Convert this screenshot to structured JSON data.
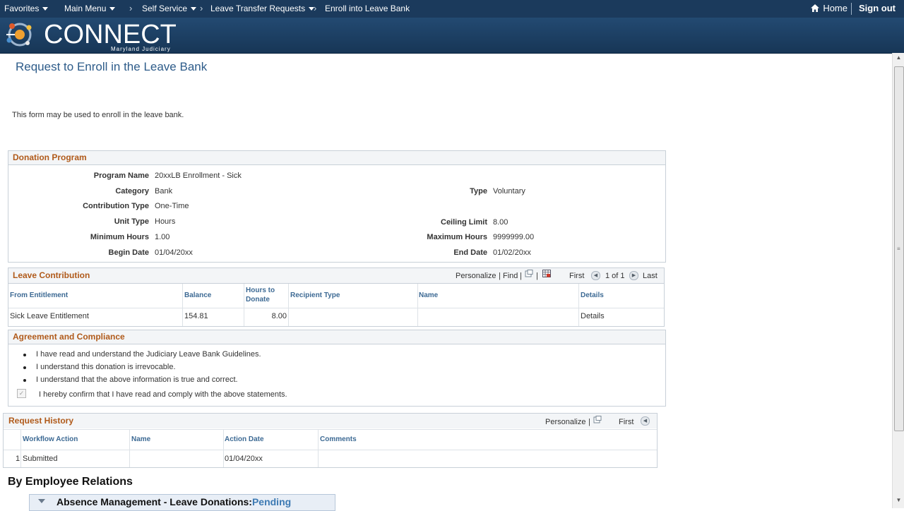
{
  "topnav": {
    "favorites": "Favorites",
    "main_menu": "Main Menu",
    "self_service": "Self Service",
    "leave_transfer": "Leave Transfer Requests",
    "current": "Enroll into Leave Bank",
    "home": "Home",
    "signout": "Sign out"
  },
  "brand": {
    "name": "CONNECT",
    "sub": "Maryland Judiciary"
  },
  "page": {
    "title": "Request to Enroll in the Leave Bank",
    "intro": "This form may be used to enroll in the leave bank."
  },
  "donation": {
    "title": "Donation Program",
    "program_name_label": "Program Name",
    "program_name": "20xxLB Enrollment - Sick",
    "category_label": "Category",
    "category": "Bank",
    "type_label": "Type",
    "type": "Voluntary",
    "contribution_type_label": "Contribution Type",
    "contribution_type": "One-Time",
    "unit_type_label": "Unit Type",
    "unit_type": "Hours",
    "ceiling_label": "Ceiling Limit",
    "ceiling": "8.00",
    "min_hours_label": "Minimum Hours",
    "min_hours": "1.00",
    "max_hours_label": "Maximum Hours",
    "max_hours": "9999999.00",
    "begin_label": "Begin Date",
    "begin": "01/04/20xx",
    "end_label": "End Date",
    "end": "01/02/20xx"
  },
  "contribution": {
    "title": "Leave Contribution",
    "personalize": "Personalize",
    "find": "Find",
    "first": "First",
    "count": "1 of 1",
    "last": "Last",
    "headers": {
      "from": "From Entitlement",
      "balance": "Balance",
      "hours_line1": "Hours to",
      "hours_line2": "Donate",
      "recipient": "Recipient Type",
      "name": "Name",
      "details": "Details"
    },
    "row": {
      "from": "Sick Leave Entitlement",
      "balance": "154.81",
      "hours": "8.00",
      "recipient": "",
      "name": "",
      "details": "Details"
    }
  },
  "agreement": {
    "title": "Agreement and Compliance",
    "items": [
      "I have read and understand the Judiciary Leave Bank Guidelines.",
      "I understand this donation is irrevocable.",
      "I understand that the above information is true and correct."
    ],
    "confirm": "I hereby confirm that I have read and comply with the above statements.",
    "confirm_checked": true
  },
  "history": {
    "title": "Request History",
    "personalize": "Personalize",
    "first": "First",
    "headers": {
      "action": "Workflow Action",
      "name": "Name",
      "date": "Action Date",
      "comments": "Comments"
    },
    "row": {
      "num": "1",
      "action": "Submitted",
      "name": "",
      "date": "01/04/20xx",
      "comments": ""
    }
  },
  "approval": {
    "heading": "By Employee Relations",
    "bar_title": "Absence Management - Leave Donations:",
    "bar_status": "Pending"
  },
  "colors": {
    "nav": "#1b3a5c",
    "section_title": "#b05a1a",
    "link": "#1f5c99"
  }
}
